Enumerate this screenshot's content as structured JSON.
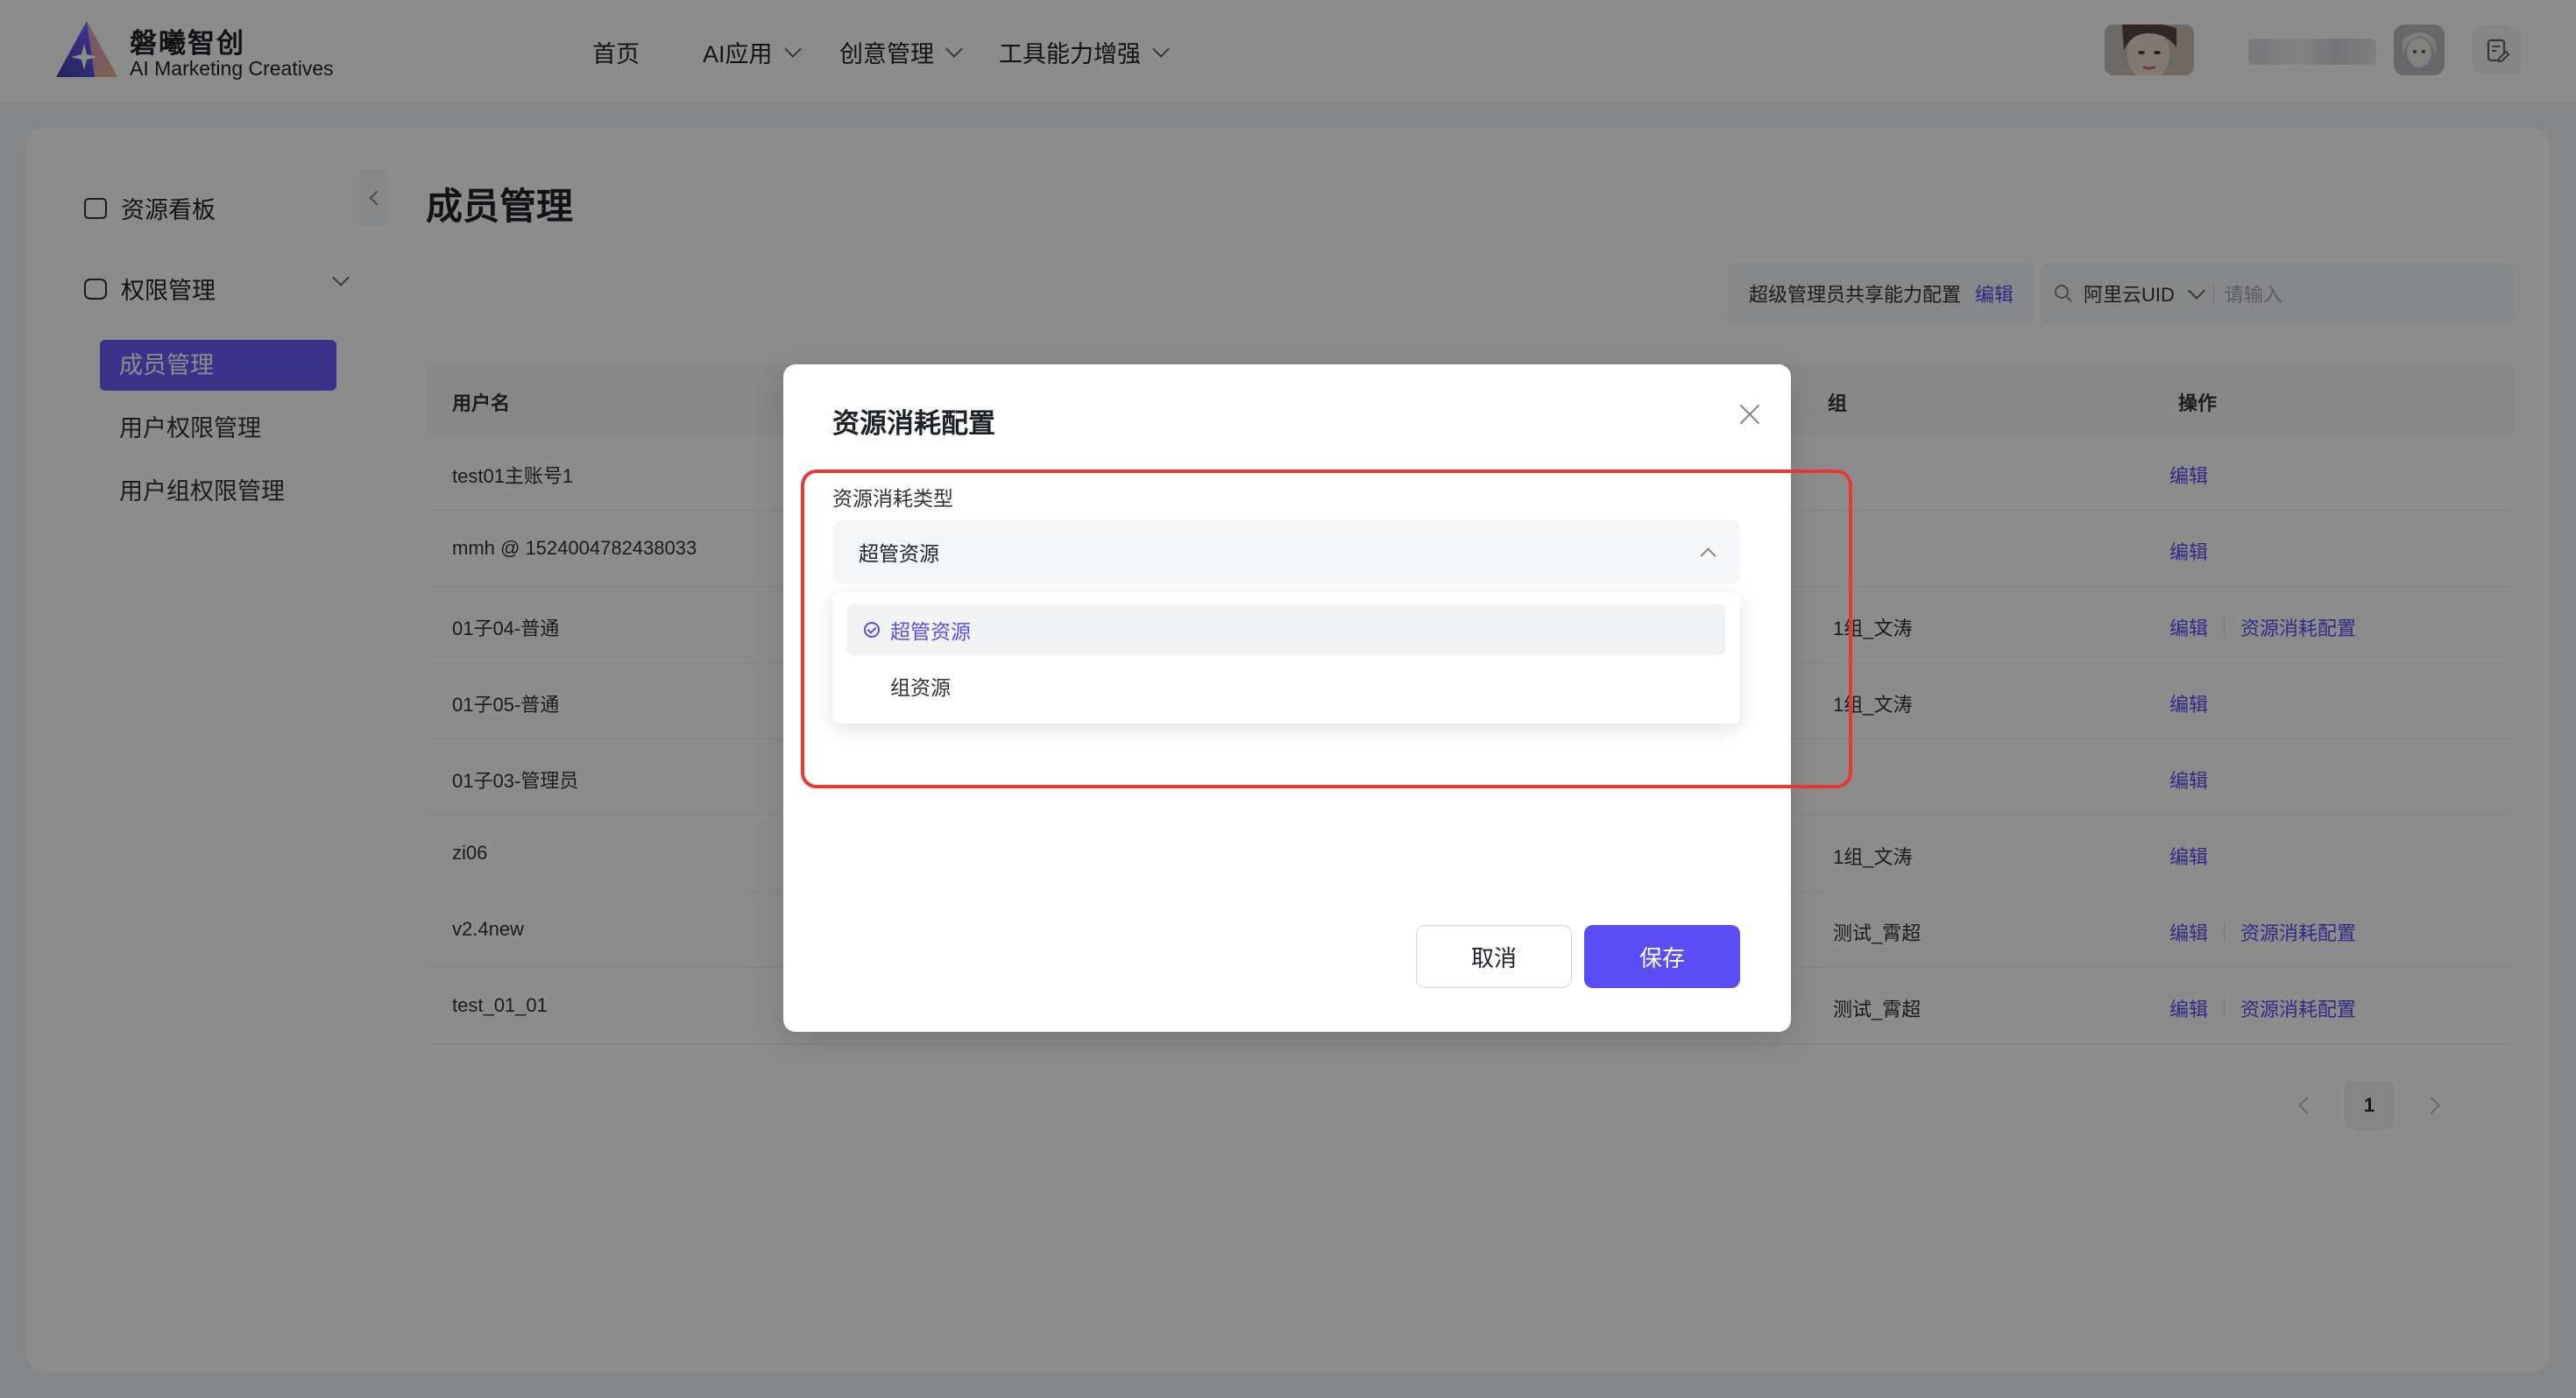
{
  "brand": {
    "name": "磐曦智创",
    "subtitle": "AI Marketing Creatives"
  },
  "nav": {
    "items": [
      {
        "label": "首页",
        "has_dropdown": false
      },
      {
        "label": "AI应用",
        "has_dropdown": true
      },
      {
        "label": "创意管理",
        "has_dropdown": true
      },
      {
        "label": "工具能力增强",
        "has_dropdown": true
      }
    ]
  },
  "sidebar": {
    "items": [
      {
        "label": "资源看板",
        "icon": "wallet-icon"
      },
      {
        "label": "权限管理",
        "icon": "lock-bag-icon"
      }
    ],
    "sub_items": [
      {
        "label": "成员管理",
        "active": true
      },
      {
        "label": "用户权限管理",
        "active": false
      },
      {
        "label": "用户组权限管理",
        "active": false
      }
    ]
  },
  "page": {
    "title": "成员管理",
    "share_config_label": "超级管理员共享能力配置",
    "share_config_link": "编辑",
    "search": {
      "filter_label": "阿里云UID",
      "placeholder": "请输入"
    }
  },
  "table": {
    "headers": {
      "username": "用户名",
      "group": "组",
      "actions": "操作"
    },
    "rows": [
      {
        "username": "test01主账号1",
        "group": "",
        "actions": [
          "编辑"
        ]
      },
      {
        "username": "mmh @ 1524004782438033",
        "group": "",
        "actions": [
          "编辑"
        ]
      },
      {
        "username": "01子04-普通",
        "group": "1组_文涛",
        "actions": [
          "编辑",
          "资源消耗配置"
        ]
      },
      {
        "username": "01子05-普通",
        "group": "1组_文涛",
        "actions": [
          "编辑"
        ]
      },
      {
        "username": "01子03-管理员",
        "group": "",
        "actions": [
          "编辑"
        ]
      },
      {
        "username": "zi06",
        "group": "1组_文涛",
        "actions": [
          "编辑"
        ]
      },
      {
        "username": "v2.4new",
        "group": "测试_霄超",
        "actions": [
          "编辑",
          "资源消耗配置"
        ]
      },
      {
        "username": "test_01_01",
        "group": "测试_霄超",
        "actions": [
          "编辑",
          "资源消耗配置"
        ]
      }
    ]
  },
  "pagination": {
    "current_page": "1"
  },
  "modal": {
    "title": "资源消耗配置",
    "field_label": "资源消耗类型",
    "selected_value": "超管资源",
    "options": [
      {
        "label": "超管资源",
        "selected": true
      },
      {
        "label": "组资源",
        "selected": false
      }
    ],
    "cancel_label": "取消",
    "save_label": "保存"
  },
  "colors": {
    "accent": "#5b4df5",
    "sidebar_active": "#6b5ef9",
    "highlight_frame": "#e53935"
  }
}
